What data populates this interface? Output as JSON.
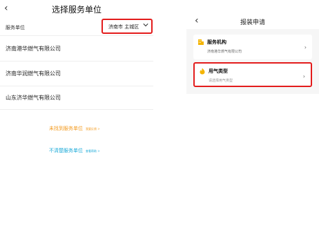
{
  "left": {
    "title": "选择服务单位",
    "filter_label": "服务单位",
    "city_selector": "济南市 主城区",
    "companies": [
      "济南港华燃气有限公司",
      "济南华润燃气有限公司",
      "山东济华燃气有限公司"
    ],
    "help1": {
      "text": "未找到服务单位",
      "link": "我要反馈 >"
    },
    "help2": {
      "text": "不清楚服务单位",
      "link": "查看帮助 >"
    }
  },
  "right": {
    "title": "报装申请",
    "org_card": {
      "title": "服务机构",
      "subtitle": "济南港华燃气有限公司"
    },
    "gas_card": {
      "title": "用气类型",
      "subtitle": "请选择用气类型"
    }
  },
  "colors": {
    "highlight_border": "#e31b1b",
    "help_orange": "#f39a1e",
    "help_blue": "#19a9d8",
    "icon_yellow": "#f4b400"
  }
}
